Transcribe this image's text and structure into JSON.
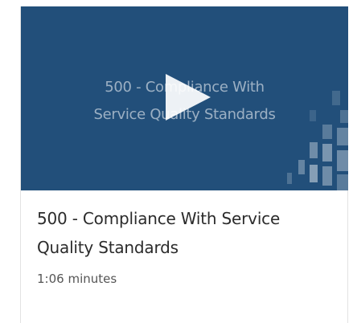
{
  "video": {
    "thumbnail_title_line1": "500 - Compliance With",
    "thumbnail_title_line2": "Service Quality Standards",
    "title": "500 - Compliance With Service Quality Standards",
    "duration": "1:06 minutes",
    "play_icon": "play-icon"
  },
  "colors": {
    "thumbnail_bg": "#224f7a",
    "title_text": "#2b2b2b",
    "duration_text": "#555555"
  }
}
